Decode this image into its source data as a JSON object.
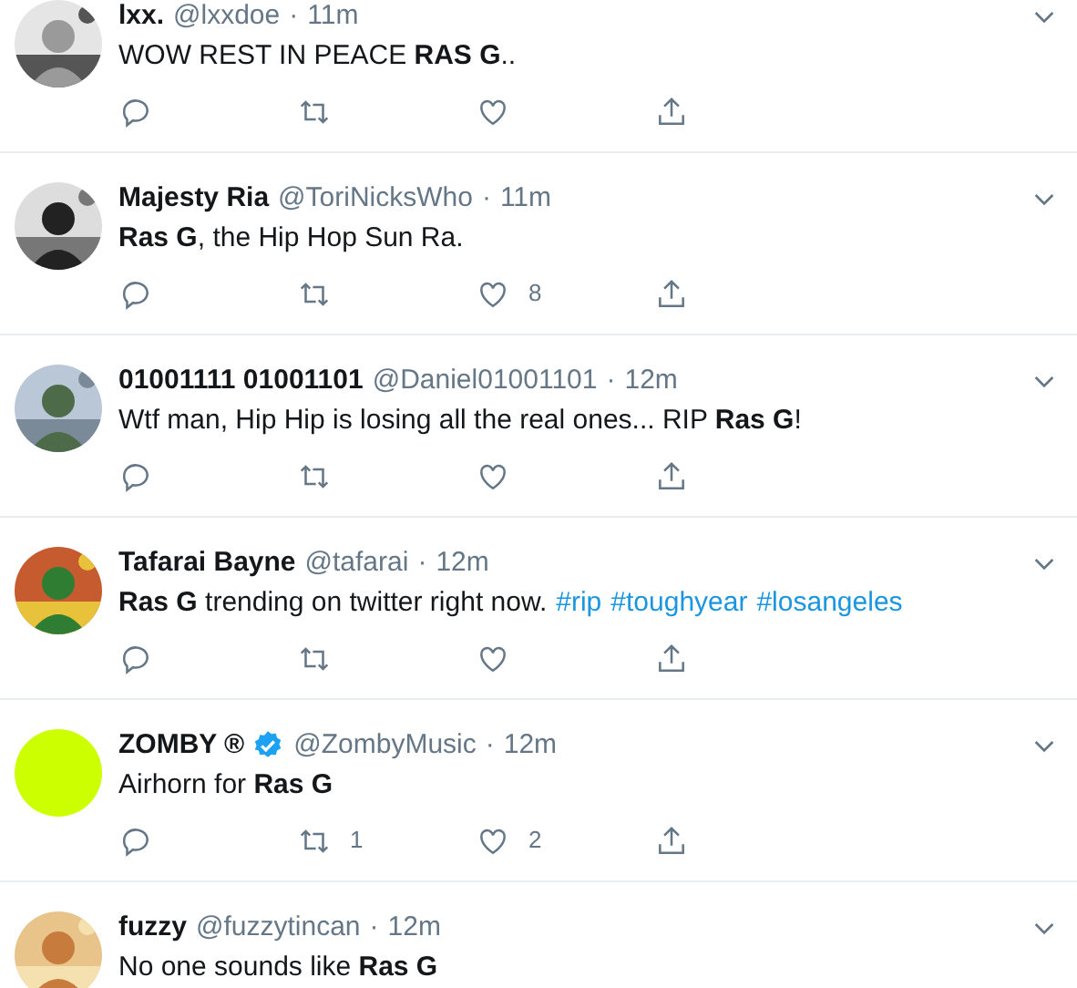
{
  "tweets": [
    {
      "name": "lxx.",
      "verified": false,
      "handle": "@lxxdoe",
      "separator": "·",
      "time": "11m",
      "body": [
        {
          "kind": "text",
          "text": "WOW REST IN PEACE **RAS G**.."
        }
      ],
      "actions": [
        {
          "kind": "reply"
        },
        {
          "kind": "retweet"
        },
        {
          "kind": "like"
        },
        {
          "kind": "share"
        }
      ]
    },
    {
      "name": "Majesty Ria",
      "verified": false,
      "handle": "@ToriNicksWho",
      "separator": "·",
      "time": "11m",
      "body": [
        {
          "kind": "text",
          "text": "**Ras G**, the Hip Hop Sun Ra."
        }
      ],
      "actions": [
        {
          "kind": "reply"
        },
        {
          "kind": "retweet"
        },
        {
          "kind": "like",
          "count": "8"
        },
        {
          "kind": "share"
        }
      ]
    },
    {
      "name": "01001111 01001101",
      "verified": false,
      "handle": "@Daniel01001101",
      "separator": "·",
      "time": "12m",
      "body": [
        {
          "kind": "text",
          "text": "Wtf man, Hip Hip is losing all the real ones... RIP **Ras G**!"
        }
      ],
      "actions": [
        {
          "kind": "reply"
        },
        {
          "kind": "retweet"
        },
        {
          "kind": "like"
        },
        {
          "kind": "share"
        }
      ]
    },
    {
      "name": "Tafarai Bayne",
      "verified": false,
      "handle": "@tafarai",
      "separator": "·",
      "time": "12m",
      "body": [
        {
          "kind": "text",
          "text": "**Ras G** trending on twitter right now."
        },
        {
          "kind": "hashtag",
          "text": "#rip"
        },
        {
          "kind": "hashtag",
          "text": "#toughyear"
        },
        {
          "kind": "hashtag",
          "text": "#losangeles"
        }
      ],
      "actions": [
        {
          "kind": "reply"
        },
        {
          "kind": "retweet"
        },
        {
          "kind": "like"
        },
        {
          "kind": "share"
        }
      ]
    },
    {
      "name": "ZOMBY ®",
      "verified": true,
      "handle": "@ZombyMusic",
      "separator": "·",
      "time": "12m",
      "avatar": {
        "kind": "solid",
        "color": "#ccff00"
      },
      "body": [
        {
          "kind": "text",
          "text": "Airhorn for **Ras G**"
        }
      ],
      "actions": [
        {
          "kind": "reply"
        },
        {
          "kind": "retweet",
          "count": "1"
        },
        {
          "kind": "like",
          "count": "2"
        },
        {
          "kind": "share"
        }
      ]
    },
    {
      "name": "fuzzy",
      "verified": false,
      "handle": "@fuzzytincan",
      "separator": "·",
      "time": "12m",
      "body": [
        {
          "kind": "text",
          "text": "No one sounds like **Ras G**"
        }
      ]
    }
  ]
}
